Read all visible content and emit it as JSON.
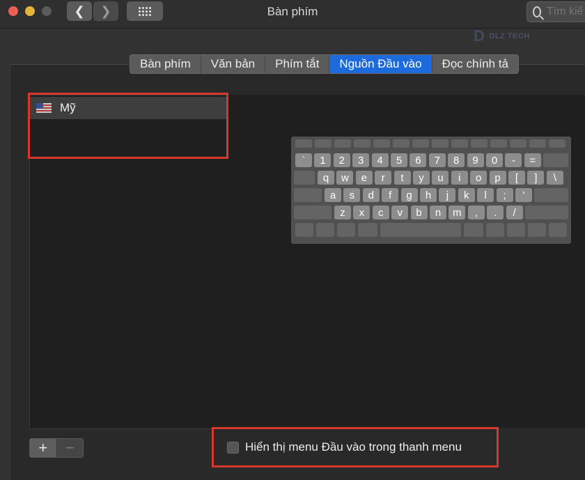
{
  "window": {
    "title": "Bàn phím"
  },
  "search": {
    "placeholder": "Tìm kiế"
  },
  "watermark": {
    "text": "DLZ TECH"
  },
  "tabs": [
    {
      "label": "Bàn phím",
      "active": false
    },
    {
      "label": "Văn bản",
      "active": false
    },
    {
      "label": "Phím tắt",
      "active": false
    },
    {
      "label": "Nguồn Đầu vào",
      "active": true
    },
    {
      "label": "Đọc chính tả",
      "active": false
    }
  ],
  "input_sources": [
    {
      "label": "Mỹ",
      "icon": "us-flag-icon",
      "selected": true
    }
  ],
  "keyboard": {
    "rows": [
      [
        "`",
        "1",
        "2",
        "3",
        "4",
        "5",
        "6",
        "7",
        "8",
        "9",
        "0",
        "-",
        "="
      ],
      [
        "q",
        "w",
        "e",
        "r",
        "t",
        "y",
        "u",
        "i",
        "o",
        "p",
        "[",
        "]",
        "\\"
      ],
      [
        "a",
        "s",
        "d",
        "f",
        "g",
        "h",
        "j",
        "k",
        "l",
        ";",
        "'"
      ],
      [
        "z",
        "x",
        "c",
        "v",
        "b",
        "n",
        "m",
        ",",
        ".",
        "/"
      ]
    ]
  },
  "controls": {
    "add_label": "+",
    "remove_label": "−"
  },
  "checkbox": {
    "label": "Hiển thị menu Đầu vào trong thanh menu",
    "checked": false
  },
  "colors": {
    "accent": "#1d6adc",
    "highlight": "#d8382c"
  }
}
